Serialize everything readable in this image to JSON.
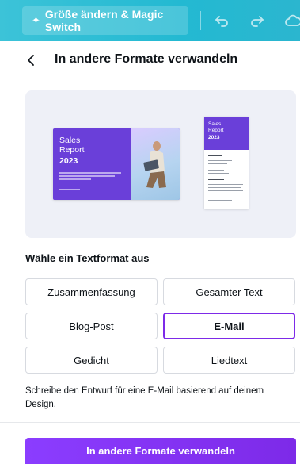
{
  "toolbar": {
    "magic_switch_label": "Größe ändern & Magic Switch",
    "icons": [
      "sparkle-icon",
      "undo-icon",
      "redo-icon",
      "cloud-icon"
    ]
  },
  "header": {
    "title": "In andere Formate verwandeln"
  },
  "preview": {
    "presentation": {
      "title_line1": "Sales",
      "title_line2": "Report",
      "year": "2023"
    },
    "document": {
      "title_line1": "Sales",
      "title_line2": "Report",
      "year": "2023"
    }
  },
  "formats": {
    "label": "Wähle ein Textformat aus",
    "options": [
      {
        "label": "Zusammenfassung"
      },
      {
        "label": "Gesamter Text"
      },
      {
        "label": "Blog-Post"
      },
      {
        "label": "E-Mail"
      },
      {
        "label": "Gedicht"
      },
      {
        "label": "Liedtext"
      }
    ],
    "selected": "E-Mail",
    "description": "Schreibe den Entwurf für eine E-Mail basierend auf deinem Design."
  },
  "footer": {
    "convert_label": "In andere Formate verwandeln"
  },
  "colors": {
    "toolbar": "#25bfd6",
    "accent": "#7d2ae8",
    "button": "#8b3dff"
  }
}
